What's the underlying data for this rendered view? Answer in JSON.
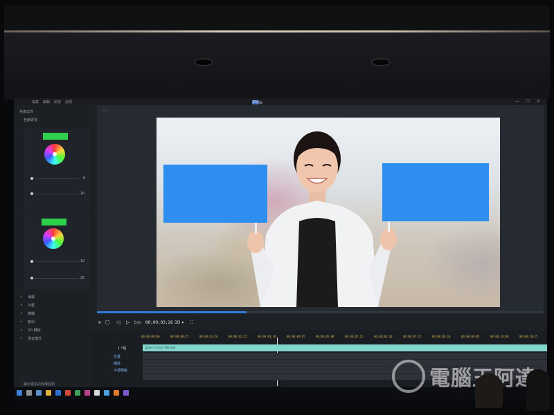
{
  "app": {
    "logo": "EX",
    "title": "語音編輯器 | green screen TW",
    "menu": [
      "檔案",
      "編輯",
      "檢視",
      "說明"
    ],
    "window_buttons": "— ☐ ✕"
  },
  "left_panel": {
    "section_title": "色度去背",
    "sub_title": "色度去背",
    "key1": {
      "color": "#2fd14c",
      "slider1_value": "6",
      "slider2_value": "20"
    },
    "key2": {
      "color": "#2fd14c",
      "slider1_value": "10",
      "slider2_value": "20"
    },
    "fx_items": [
      "漸層",
      "外框",
      "模糊",
      "銳利",
      "3D 轉換",
      "混合模式"
    ],
    "footer": "顯示更多的效果控制"
  },
  "viewer": {
    "tab_label": "‹  ›",
    "progress": 0.335,
    "sign_color": "#2e8ff0"
  },
  "transport": {
    "pause_icon": "⏸",
    "stop_icon": "□",
    "prev_icon": "◁",
    "play_icon": "▷",
    "next_icon": "▷▷",
    "timecode": "00;00;03;26",
    "mode": "3D ▾",
    "fullscreen_icon": "⛶"
  },
  "timeline": {
    "ruler_labels": [
      "00;00;00;00",
      "00;00;00;25",
      "00;00;01;20",
      "00;00;02;15",
      "00;00;03;10",
      "00;00;04;05",
      "00;00;05;00",
      "00;00;05;25",
      "00;00;06;20",
      "00;00;07;15",
      "00;00;08;10",
      "00;00;09;05",
      "00;00;10;00",
      "00;00;10;25"
    ],
    "clip_label": "green screen TW.mp4",
    "track_name": "1.*視",
    "tracks": [
      "位置",
      "縮放",
      "不透明度"
    ]
  },
  "watermark": "電腦王阿達"
}
